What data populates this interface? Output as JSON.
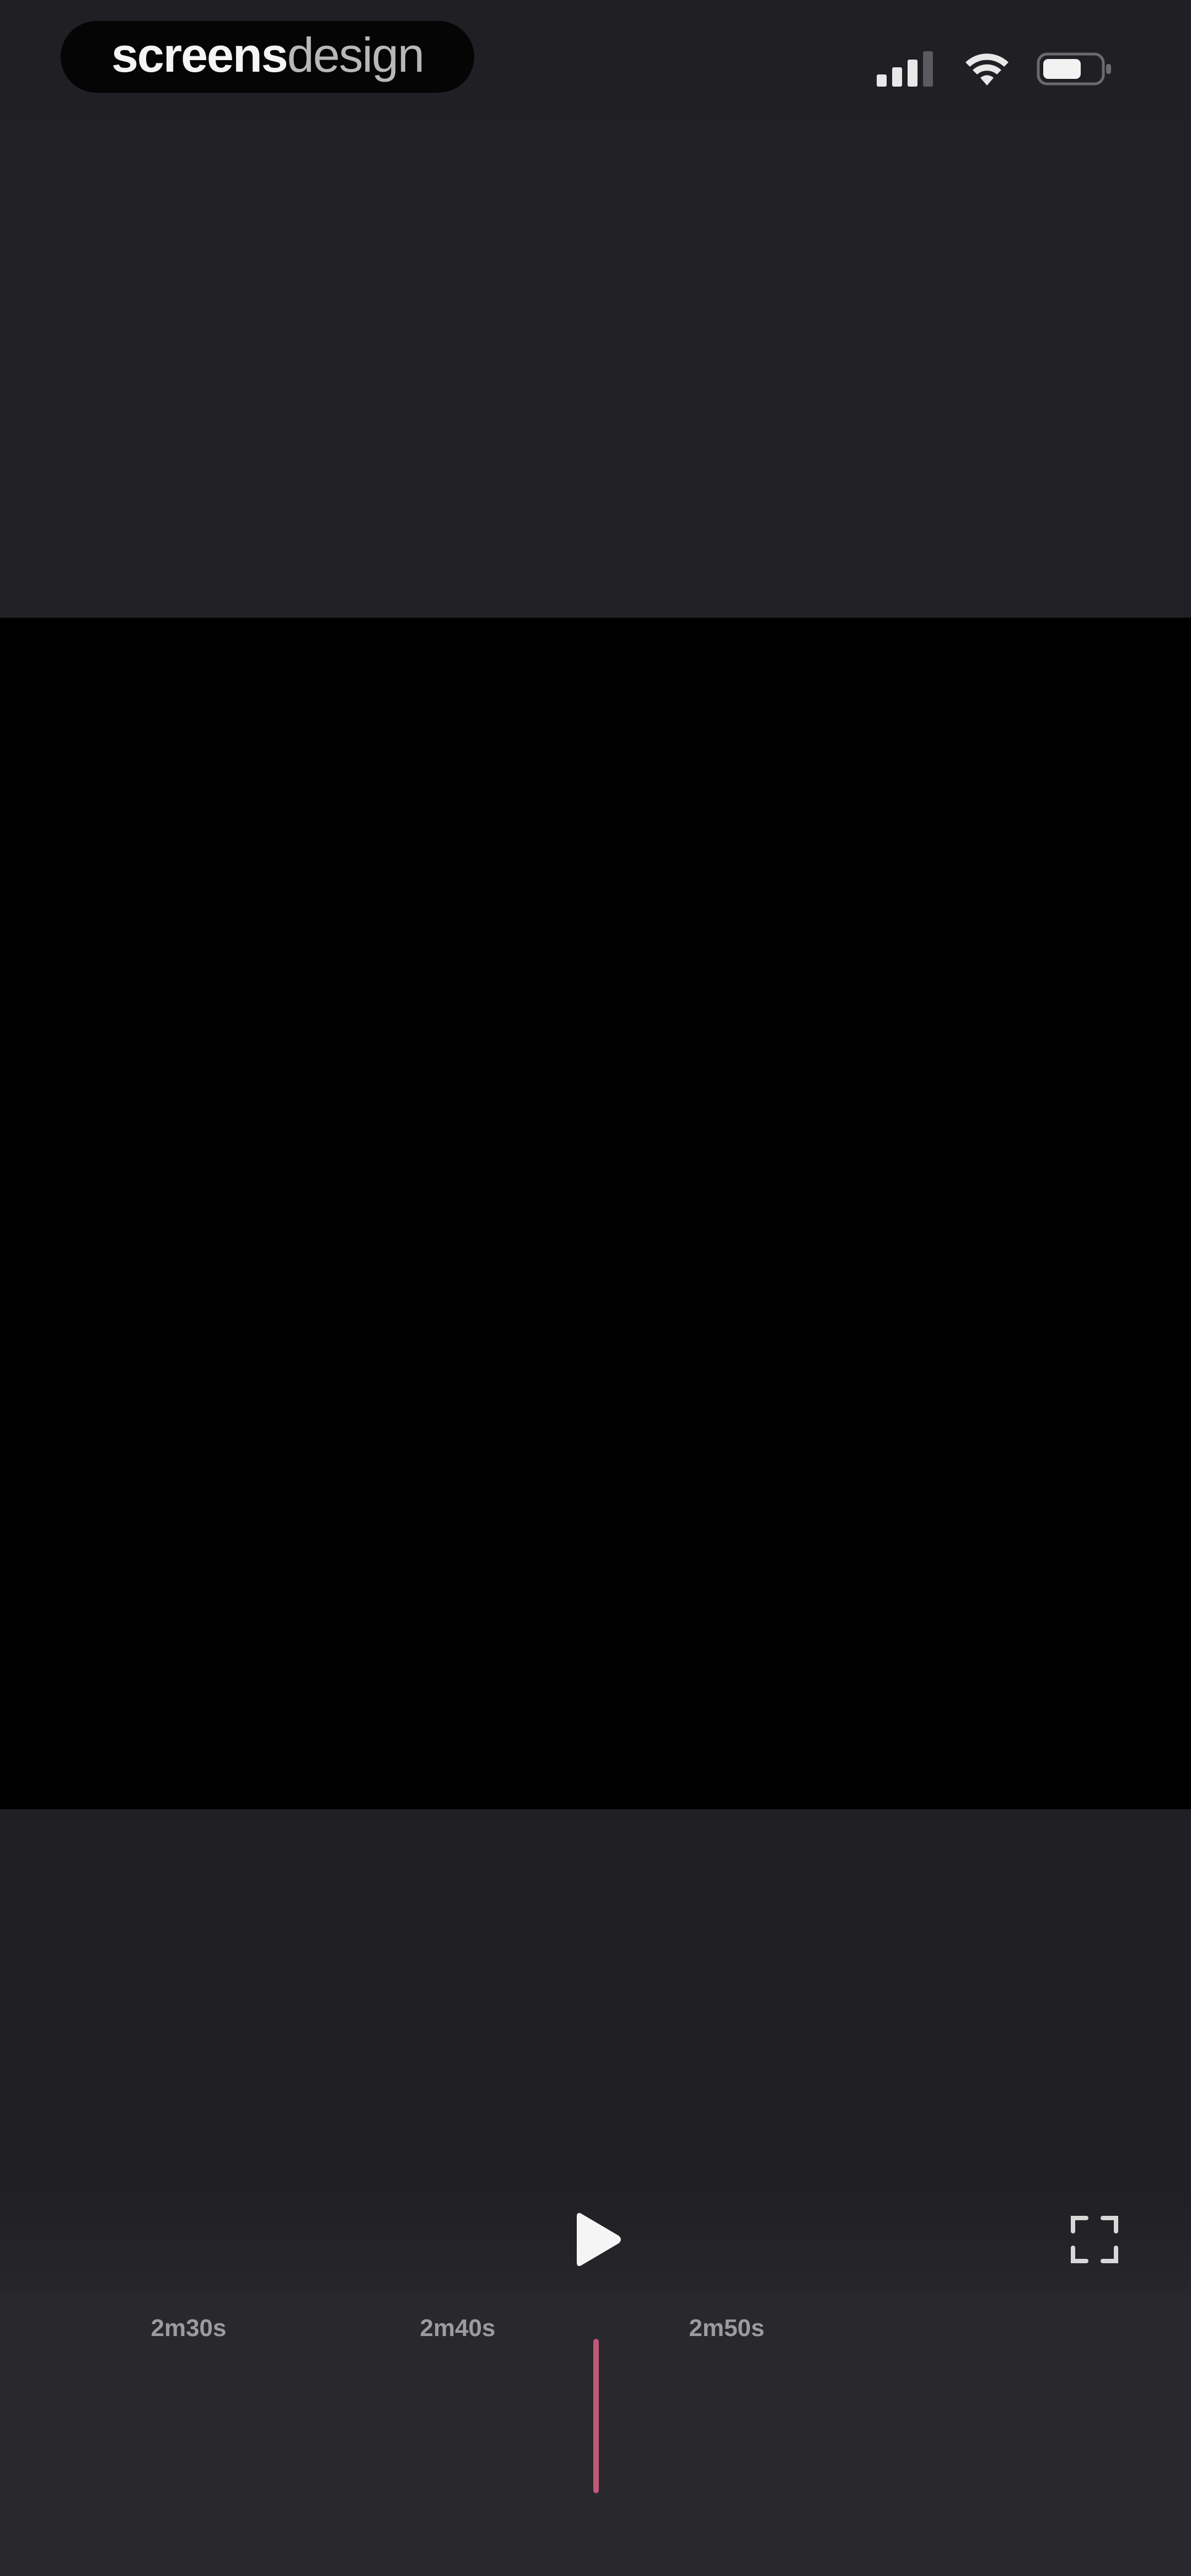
{
  "status_bar": {
    "brand": {
      "bold": "screens",
      "light": "design"
    },
    "icons": [
      "signal-icon",
      "wifi-icon",
      "battery-icon"
    ]
  },
  "player": {
    "controls": {
      "play_icon": "play-icon",
      "fullscreen_icon": "fullscreen-icon"
    },
    "timeline": {
      "ticks": [
        "2m30s",
        "2m40s",
        "2m50s"
      ],
      "playhead_color": "#c25878"
    }
  },
  "colors": {
    "background": "#1f1f24",
    "video": "#000000",
    "timeline": "#28282d",
    "accent": "#c25878"
  }
}
